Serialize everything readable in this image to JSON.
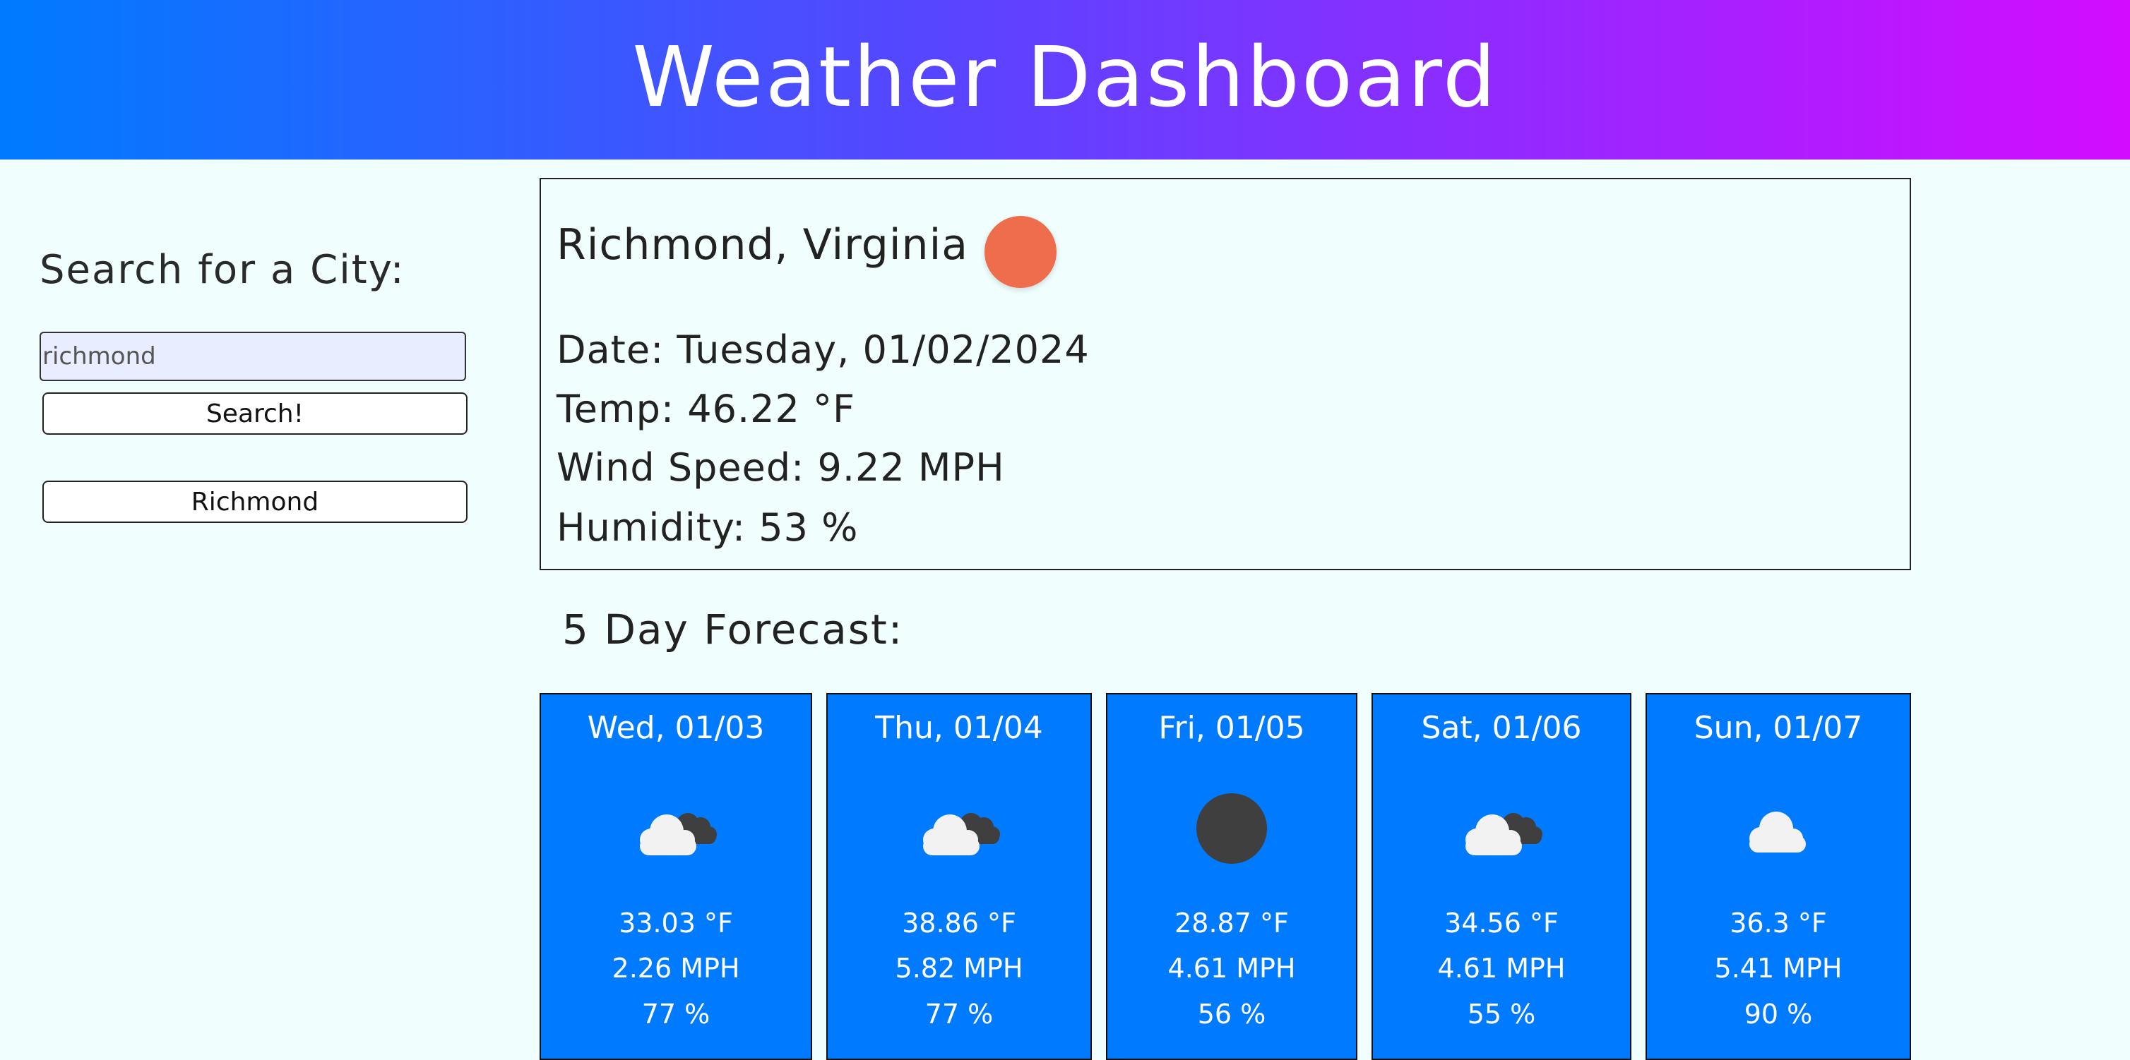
{
  "header": {
    "title": "Weather Dashboard"
  },
  "search": {
    "title": "Search for a City:",
    "value": "richmond",
    "button_label": "Search!",
    "history": [
      "Richmond"
    ]
  },
  "current": {
    "city": "Richmond, Virginia",
    "icon": "clear-sun-icon",
    "date": "Date: Tuesday, 01/02/2024",
    "temp": "Temp: 46.22 °F",
    "wind": "Wind Speed: 9.22 MPH",
    "humidity": "Humidity: 53 %"
  },
  "forecast": {
    "title": "5 Day Forecast:",
    "days": [
      {
        "date": "Wed, 01/03",
        "icon": "broken-clouds-icon",
        "temp": "33.03 °F",
        "wind": "2.26 MPH",
        "humidity": "77 %"
      },
      {
        "date": "Thu, 01/04",
        "icon": "broken-clouds-icon",
        "temp": "38.86 °F",
        "wind": "5.82 MPH",
        "humidity": "77 %"
      },
      {
        "date": "Fri, 01/05",
        "icon": "clear-night-icon",
        "temp": "28.87 °F",
        "wind": "4.61 MPH",
        "humidity": "56 %"
      },
      {
        "date": "Sat, 01/06",
        "icon": "broken-clouds-icon",
        "temp": "34.56 °F",
        "wind": "4.61 MPH",
        "humidity": "55 %"
      },
      {
        "date": "Sun, 01/07",
        "icon": "cloud-icon",
        "temp": "36.3 °F",
        "wind": "5.41 MPH",
        "humidity": "90 %"
      }
    ]
  },
  "colors": {
    "card": "#007bff",
    "sun": "#ee6d4c",
    "background": "#f0fffe"
  }
}
